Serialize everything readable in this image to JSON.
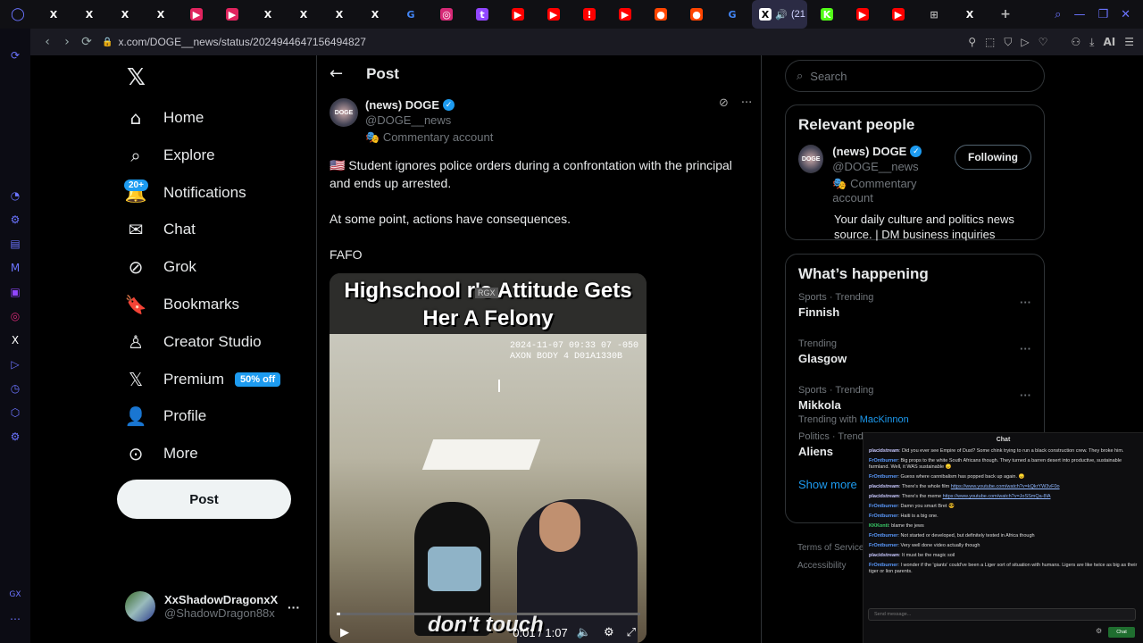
{
  "browser": {
    "url": "x.com/DOGE__news/status/2024944647156494827",
    "active_tab_count": "(21",
    "tabs": [
      {
        "icon": "x-logo-icon",
        "color": "#ffffff",
        "glyph": "X"
      },
      {
        "icon": "x-logo-icon",
        "color": "#ffffff",
        "glyph": "X"
      },
      {
        "icon": "x-logo-icon",
        "color": "#ffffff",
        "glyph": "X"
      },
      {
        "icon": "x-logo-icon",
        "color": "#ffffff",
        "glyph": "X"
      },
      {
        "icon": "flag-red-icon",
        "color": "#e0245e",
        "glyph": "▶"
      },
      {
        "icon": "flag-red-icon",
        "color": "#e0245e",
        "glyph": "▶"
      },
      {
        "icon": "x-logo-icon",
        "color": "#ffffff",
        "glyph": "X"
      },
      {
        "icon": "x-logo-icon",
        "color": "#ffffff",
        "glyph": "X"
      },
      {
        "icon": "x-logo-icon",
        "color": "#ffffff",
        "glyph": "X"
      },
      {
        "icon": "x-logo-icon",
        "color": "#ffffff",
        "glyph": "X"
      },
      {
        "icon": "google-icon",
        "color": "#4285f4",
        "glyph": "G"
      },
      {
        "icon": "instagram-icon",
        "color": "#d62976",
        "glyph": "◎"
      },
      {
        "icon": "twitch-icon",
        "color": "#9146ff",
        "glyph": "t"
      },
      {
        "icon": "youtube-icon",
        "color": "#ff0000",
        "glyph": "▶"
      },
      {
        "icon": "youtube-icon",
        "color": "#ff0000",
        "glyph": "▶"
      },
      {
        "icon": "alert-icon",
        "color": "#ff0000",
        "glyph": "!"
      },
      {
        "icon": "youtube-icon",
        "color": "#ff0000",
        "glyph": "▶"
      },
      {
        "icon": "reddit-icon",
        "color": "#ff4500",
        "glyph": "●"
      },
      {
        "icon": "reddit-icon",
        "color": "#ff4500",
        "glyph": "●"
      },
      {
        "icon": "google-icon",
        "color": "#4285f4",
        "glyph": "G"
      }
    ],
    "tabs_after": [
      {
        "icon": "kick-icon",
        "color": "#53fc18",
        "glyph": "K"
      },
      {
        "icon": "youtube-icon",
        "color": "#ff0000",
        "glyph": "▶"
      },
      {
        "icon": "youtube-icon",
        "color": "#ff0000",
        "glyph": "▶"
      },
      {
        "icon": "grid-icon",
        "color": "#bbbbbb",
        "glyph": "⊞"
      },
      {
        "icon": "x-logo-icon",
        "color": "#ffffff",
        "glyph": "X"
      }
    ],
    "ai_label": "AI"
  },
  "nav": {
    "items": [
      {
        "label": "Home",
        "icon": "home-icon"
      },
      {
        "label": "Explore",
        "icon": "search-icon"
      },
      {
        "label": "Notifications",
        "icon": "bell-icon",
        "badge": "20+"
      },
      {
        "label": "Chat",
        "icon": "mail-icon"
      },
      {
        "label": "Grok",
        "icon": "grok-icon"
      },
      {
        "label": "Bookmarks",
        "icon": "bookmark-icon"
      },
      {
        "label": "Creator Studio",
        "icon": "creator-icon"
      },
      {
        "label": "Premium",
        "icon": "x-logo-icon",
        "promo": "50% off"
      },
      {
        "label": "Profile",
        "icon": "person-icon"
      },
      {
        "label": "More",
        "icon": "more-circle-icon"
      }
    ],
    "post_button": "Post",
    "account": {
      "name": "XxShadowDragonxX",
      "handle": "@ShadowDragon88x"
    }
  },
  "post": {
    "header": "Post",
    "author": {
      "name": "(news) DOGE",
      "handle": "@DOGE__news",
      "label": "Commentary account",
      "avatar_text": "DOGE"
    },
    "text1": "🇺🇸 Student ignores police orders during a confrontation with the principal and ends up arrested.",
    "text2": "At some point, actions have consequences.",
    "text3": "FAFO",
    "video": {
      "title": "Highschool r's Attitude Gets Her A Felony",
      "watermark": "RGX",
      "stamp1": "2024-11-07 09:33 07 -050",
      "stamp2": "AXON BODY 4 D01A1330B",
      "caption": "don't touch",
      "time": "0:01 / 1:07",
      "progress": 0.013
    }
  },
  "right": {
    "search_placeholder": "Search",
    "relevant": {
      "title": "Relevant people",
      "name": "(news) DOGE",
      "handle": "@DOGE__news",
      "label": "Commentary account",
      "bio": "Your daily culture and politics news source. | DM business inquiries",
      "follow": "Following"
    },
    "happening": {
      "title": "What’s happening",
      "trends": [
        {
          "meta": "Sports · Trending",
          "name": "Finnish",
          "with": "",
          "with_link": ""
        },
        {
          "meta": "Trending",
          "name": "Glasgow",
          "with": "",
          "with_link": ""
        },
        {
          "meta": "Sports · Trending",
          "name": "Mikkola",
          "with": "Trending with",
          "with_link": "MacKinnon"
        },
        {
          "meta": "Politics · Trend",
          "name": "Aliens",
          "with": "",
          "with_link": ""
        }
      ],
      "show_more": "Show more"
    },
    "footer1": "Terms of Service",
    "footer2": "Accessibility"
  },
  "chat": {
    "title": "Chat",
    "placeholder": "Send message...",
    "send": "Chat",
    "messages": [
      {
        "user": "placidstream",
        "text": "Did you ever see Empire of Dust? Some chink trying to run a black construction crew. They broke him.",
        "link": ""
      },
      {
        "user": "FrOntburner",
        "text": "Big props to the white South Africans though. They turned a barren desert into productive, sustainable farmland. Well, it WAS sustainable 😞",
        "link": ""
      },
      {
        "user": "FrOntburner",
        "text": "Guess where cannibalism has popped back up again. 😞",
        "link": ""
      },
      {
        "user": "placidstream",
        "text": "There's the whole film ",
        "link": "https://www.youtube.com/watch?v=kQkrYW3vF0o"
      },
      {
        "user": "placidstream",
        "text": "There's the meme ",
        "link": "https://www.youtube.com/watch?v=JoSSmQa-8lA"
      },
      {
        "user": "FrOntburner",
        "text": "Damn you smart Bret 😎",
        "link": ""
      },
      {
        "user": "FrOntburner",
        "text": "Haiti is a big one.",
        "link": ""
      },
      {
        "user": "KKKonti",
        "text": "blame the jews",
        "link": ""
      },
      {
        "user": "FrOntburner",
        "text": "Not started or developed, but definitely tested in Africa though",
        "link": ""
      },
      {
        "user": "FrOntburner",
        "text": "Very well done video actually though",
        "link": ""
      },
      {
        "user": "placidstream",
        "text": "It must be the magic soil",
        "link": ""
      },
      {
        "user": "FrOntburner",
        "text": "I wonder if the 'giants' could've been a Liger sort of situation with humans. Ligers are like twice as big as their tiger or lion parents.",
        "link": ""
      }
    ]
  },
  "colors": {
    "accent": "#1d9bf0",
    "background": "#000000",
    "browser_accent": "#6b74ff"
  }
}
